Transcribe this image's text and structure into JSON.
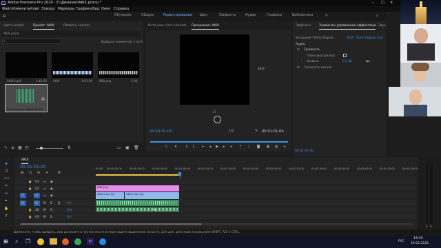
{
  "window": {
    "title": "Adobe Premiere Pro 2020 - E:\\Дима\\мк\\AKIX.prproj *"
  },
  "menu": [
    "Файл",
    "Изменить",
    "Клип",
    "Эпизод",
    "Маркеры",
    "Графика",
    "Вид",
    "Окно",
    "Справка"
  ],
  "workspaces": [
    "Обучение",
    "Сборка",
    "Редактирование",
    "Цвет",
    "Эффекты",
    "Аудио",
    "Графика",
    "Библиотеки"
  ],
  "project_panel": {
    "tabs": [
      "Цвет Lumetri",
      "Проект: AKIX",
      "Область Lumetri"
    ],
    "project_file": "AKIX.prproj",
    "selection_info": "Выбрано элементов: 1 из 4",
    "items": [
      {
        "name": "AKIX.mp4",
        "duration": "4:43:62"
      },
      {
        "name": "AKIX",
        "duration": "1:01:00"
      },
      {
        "name": "808.png",
        "duration": "5:00"
      },
      {
        "name": "Boris Magnon Noise",
        "duration": "1:21:38484"
      }
    ]
  },
  "source_monitor": {
    "tab": "Источник: (нет клипов)"
  },
  "program_monitor": {
    "tab": "Программа: AKIX",
    "timecode_left": "00:01:01:00",
    "timecode_right": "00:01:01:00",
    "zoom_fraction": "1/2",
    "side_value": "48,6",
    "bottom_value": "13"
  },
  "effect_controls": {
    "tabs": [
      "Эффекты",
      "Элементы управления эффектами",
      "Звук"
    ],
    "clip_label": "Исходный * Boris Magnon...",
    "sequence_label": "AKIX * Boris Magnon Cad...",
    "section": "Аудио",
    "effect_name": "Громкость",
    "bypass_label": "Полосовой фильтр",
    "level_label": "Уровень",
    "level_value": "0,0 дБ",
    "channel_label": "Громкость канала",
    "timecode": "00:01:01:00"
  },
  "timeline": {
    "tab": "AKIX",
    "timecode": "00:01:01:00",
    "ruler": [
      "00:00",
      "00:00:15:00",
      "00:00:30:00",
      "00:00:45:00",
      "00:01:00:00",
      "00:01:15:00",
      "00:01:30:00",
      "00:01:45:00",
      "00:02:00:00",
      "00:02:15:00",
      "00:02:30:00",
      "00:02:45:00",
      "00:03:00:00",
      "00:03:15:00",
      "00:03:30:00"
    ],
    "tracks": [
      "V3",
      "V2",
      "V1",
      "A1",
      "A2",
      "A3"
    ],
    "source_patch": {
      "video": "V1",
      "audio": "A1"
    },
    "track_volume": "0,0",
    "clips": {
      "graphic": "808.png",
      "video1": "AKIX.mp4 [V]",
      "video2": "AKIX.mp4 [V]"
    }
  },
  "status_bar": {
    "text": "Щелкните, чтобы выбрать, или щелкните в пустом месте и перетащите выделение области. Для доп. действий используйте SHIFT, ALT и CTRL."
  },
  "taskbar": {
    "time": "14:43",
    "date": "19.02.2021",
    "lang": "РУС"
  },
  "colors": {
    "accent": "#3f8fe8",
    "clip_graphic": "#e48ce8",
    "clip_video": "#8fb8f0",
    "clip_audio": "#3a8c5a"
  }
}
